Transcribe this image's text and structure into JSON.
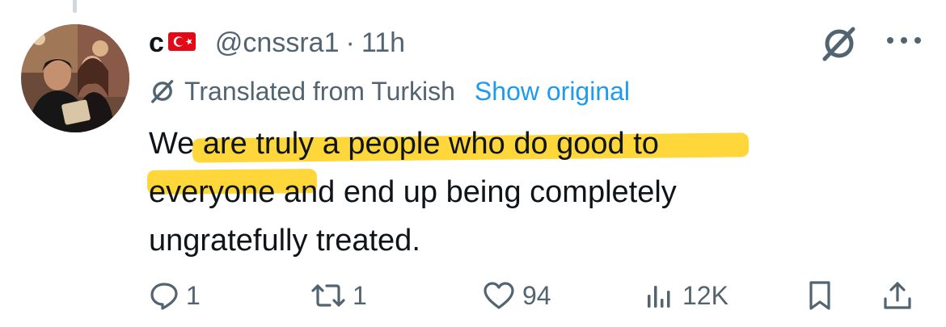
{
  "tweet": {
    "display_name": "c",
    "handle": "@cnssra1",
    "separator": "·",
    "time": "11h",
    "translation": {
      "label": "Translated from Turkish",
      "link": "Show original"
    },
    "text_lines": [
      "We are truly a people who do good to",
      "everyone and end up being completely",
      "ungratefully treated."
    ],
    "stats": {
      "replies": "1",
      "reposts": "1",
      "likes": "94",
      "views": "12K"
    }
  },
  "icons": {
    "flag": "turkey-flag-icon",
    "grok": "grok-icon",
    "more": "more-icon",
    "reply": "reply-icon",
    "repost": "repost-icon",
    "like": "heart-icon",
    "views": "views-icon",
    "bookmark": "bookmark-icon",
    "share": "share-icon"
  },
  "colors": {
    "text": "#0f1419",
    "secondary": "#536471",
    "link": "#1d9bf0",
    "highlight": "#ffd42a",
    "flag_red": "#e30a17"
  }
}
